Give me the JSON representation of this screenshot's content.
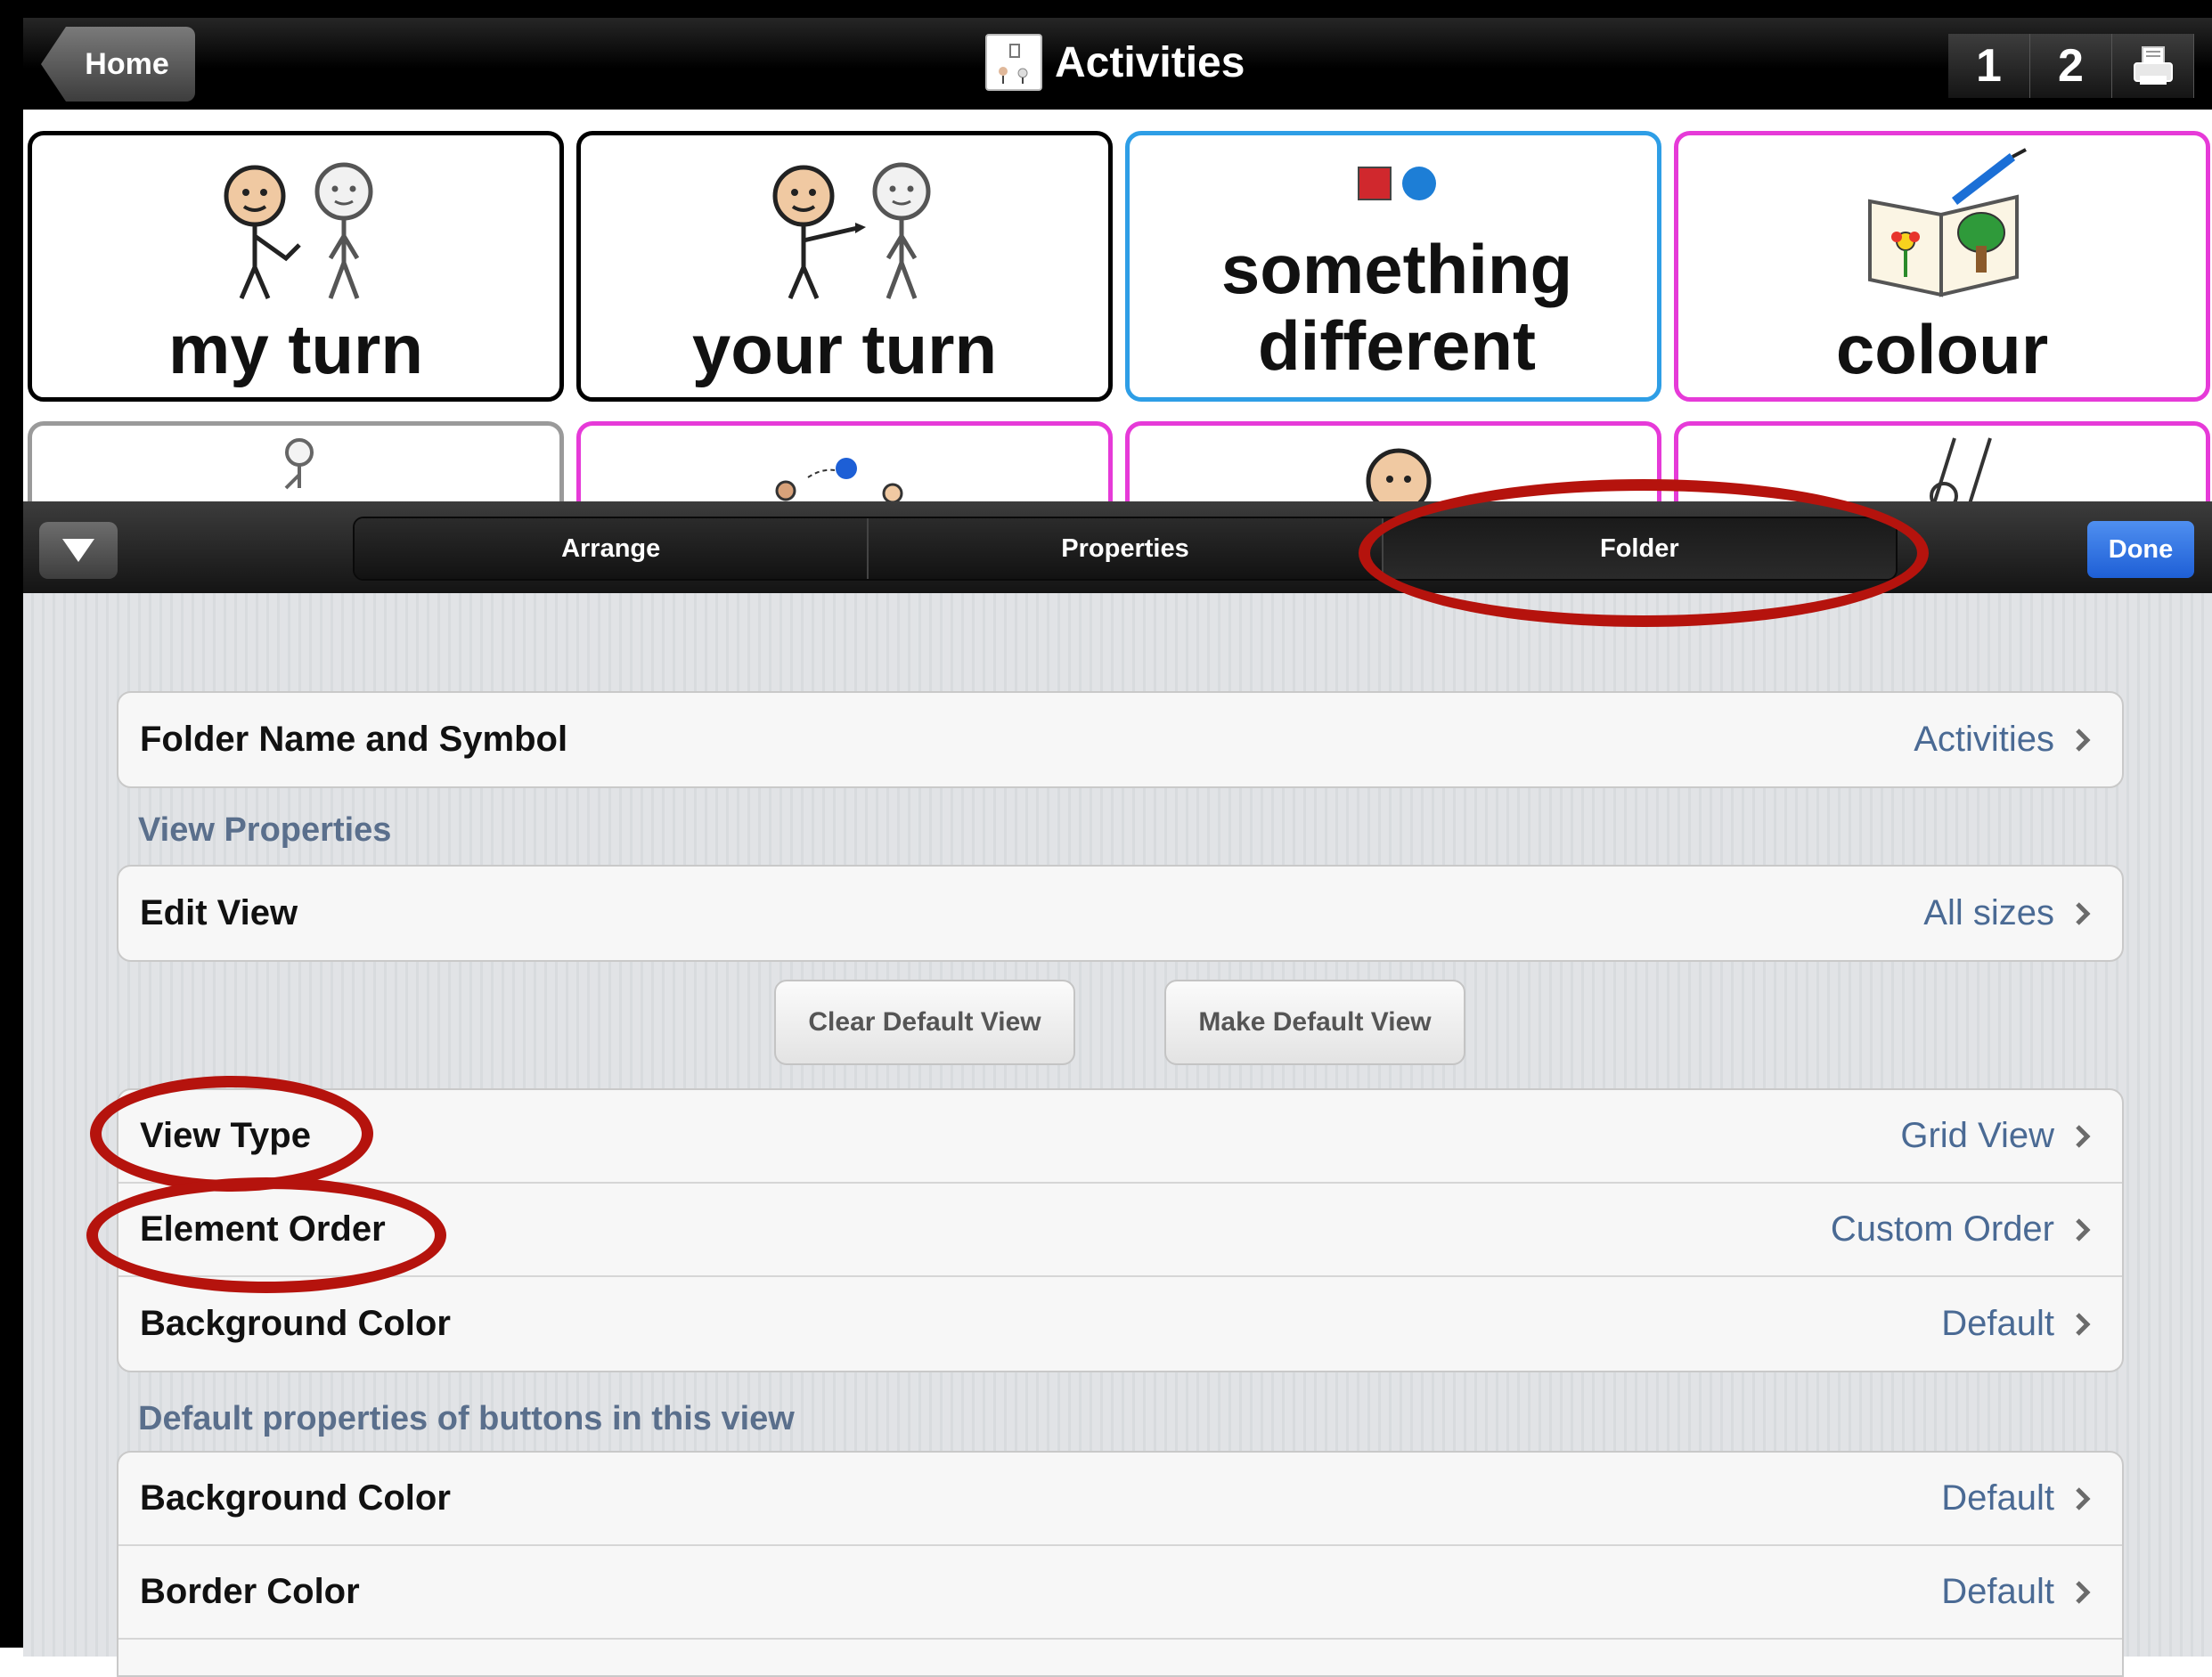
{
  "topbar": {
    "home_label": "Home",
    "title": "Activities",
    "page_buttons": [
      "1",
      "2"
    ],
    "printer_icon": "printer-icon"
  },
  "grid": {
    "cells": [
      {
        "label": "my turn",
        "border": "#000000"
      },
      {
        "label": "your turn",
        "border": "#000000"
      },
      {
        "label": "something different",
        "border": "#2e9ee6"
      },
      {
        "label": "colour",
        "border": "#e63ad8"
      }
    ]
  },
  "toolbar": {
    "tabs": [
      "Arrange",
      "Properties",
      "Folder"
    ],
    "active_tab": "Folder",
    "done_label": "Done"
  },
  "settings": {
    "folder_name_row": {
      "label": "Folder Name and Symbol",
      "value": "Activities"
    },
    "view_properties_header": "View Properties",
    "edit_view_row": {
      "label": "Edit View",
      "value": "All sizes"
    },
    "clear_default_view": "Clear Default View",
    "make_default_view": "Make Default View",
    "view_rows": [
      {
        "label": "View Type",
        "value": "Grid View"
      },
      {
        "label": "Element Order",
        "value": "Custom Order"
      },
      {
        "label": "Background Color",
        "value": "Default"
      }
    ],
    "defaults_header": "Default properties of buttons in this view",
    "button_rows": [
      {
        "label": "Background Color",
        "value": "Default"
      },
      {
        "label": "Border Color",
        "value": "Default"
      }
    ]
  },
  "annotation_color": "#b5130d"
}
